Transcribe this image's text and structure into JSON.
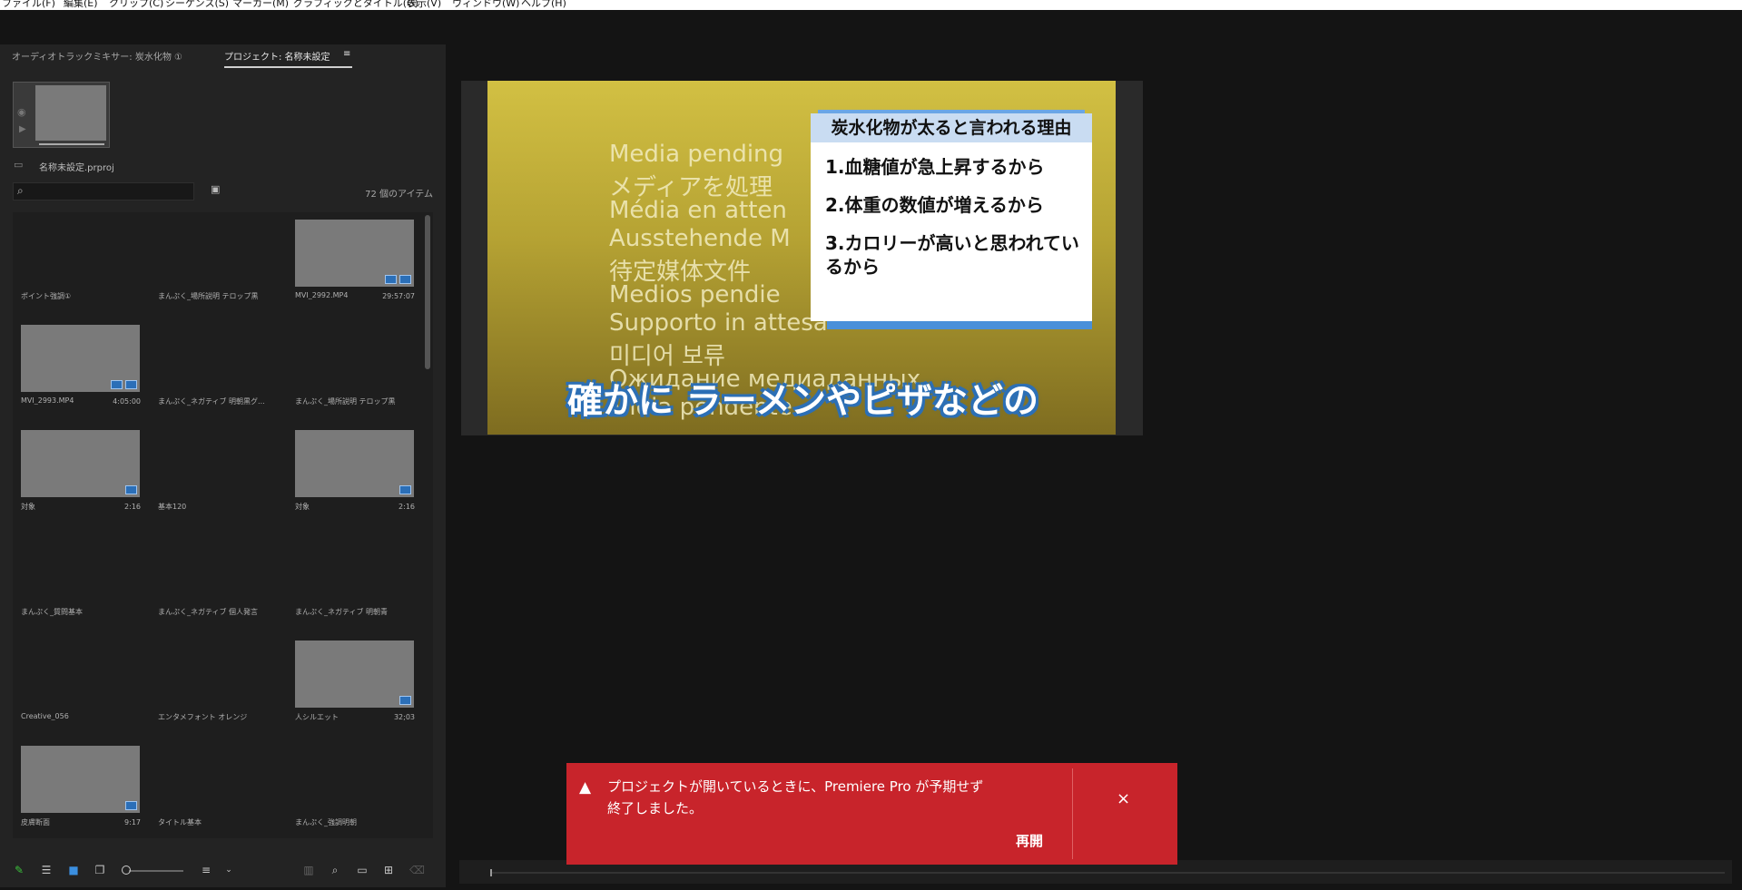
{
  "menu": {
    "items": [
      "ファイル(F)",
      "編集(E)",
      "クリップ(C)",
      "シーケンス(S)",
      "マーカー(M)",
      "グラフィックとタイトル(G)",
      "表示(V)",
      "ウィンドウ(W)",
      "ヘルプ(H)"
    ]
  },
  "project_panel": {
    "tab_audio_mixer": "オーディオトラックミキサー: 炭水化物 ①",
    "tab_project": "プロジェクト: 名称未設定",
    "project_file": "名称未設定.prproj",
    "item_count": "72 個のアイテム",
    "items": [
      {
        "name": "ポイント強調①",
        "duration": "",
        "thumb": false
      },
      {
        "name": "まんぷく_場所説明 テロップ黒",
        "duration": "",
        "thumb": false
      },
      {
        "name": "MVI_2992.MP4",
        "duration": "29:57:07",
        "thumb": true
      },
      {
        "name": "MVI_2993.MP4",
        "duration": "4:05:00",
        "thumb": true
      },
      {
        "name": "まんぷく_ネガティブ 明朝黒グ...",
        "duration": "",
        "thumb": false
      },
      {
        "name": "まんぷく_場所説明 テロップ黒",
        "duration": "",
        "thumb": false
      },
      {
        "name": "対象",
        "duration": "2:16",
        "thumb": true
      },
      {
        "name": "基本120",
        "duration": "",
        "thumb": false
      },
      {
        "name": "対象",
        "duration": "2:16",
        "thumb": true
      },
      {
        "name": "まんぷく_質問基本",
        "duration": "",
        "thumb": false
      },
      {
        "name": "まんぷく_ネガティブ 個人発言",
        "duration": "",
        "thumb": false
      },
      {
        "name": "まんぷく_ネガティブ 明朝青",
        "duration": "",
        "thumb": false
      },
      {
        "name": "Creative_056",
        "duration": "",
        "thumb": false
      },
      {
        "name": "エンタメフォント オレンジ",
        "duration": "",
        "thumb": false
      },
      {
        "name": "人シルエット",
        "duration": "32;03",
        "thumb": true
      },
      {
        "name": "皮膚断面",
        "duration": "9:17",
        "thumb": true
      },
      {
        "name": "タイトル基本",
        "duration": "",
        "thumb": false
      },
      {
        "name": "まんぷく_強調明朝",
        "duration": "",
        "thumb": false
      }
    ]
  },
  "monitor": {
    "media_pending_lines": [
      "Media pending",
      "メディアを処理",
      "Média en atten",
      "Ausstehende M",
      "待定媒体文件",
      "Medios pendie",
      "Supporto in attesa",
      "미디어 보류",
      "Ожидание медиаданных",
      "Mídia pendente"
    ],
    "card_title": "炭水化物が太ると言われる理由",
    "card_items": [
      "1.血糖値が急上昇するから",
      "2.体重の数値が増えるから",
      "3.カロリーが高いと思われているから"
    ],
    "subtitle": "確かに ラーメンやピザなどの"
  },
  "error_toast": {
    "message": "プロジェクトが開いているときに、Premiere Pro が予期せず終了しました。",
    "reopen_label": "再開",
    "close_label": "×",
    "color": "#c8242b"
  }
}
